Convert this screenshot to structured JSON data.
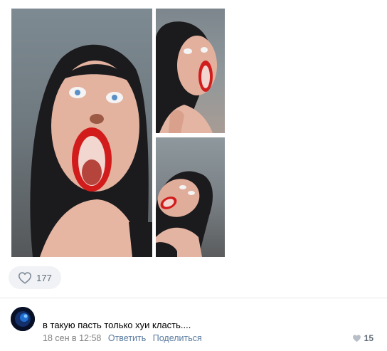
{
  "post": {
    "photos": [
      {
        "id": "photo-main",
        "description": "woman with dark hair screaming, red lipstick"
      },
      {
        "id": "photo-top-right",
        "description": "woman screaming, hand near neck"
      },
      {
        "id": "photo-bottom-right",
        "description": "woman screaming, head tilted"
      }
    ],
    "likes": "177",
    "like_icon": "heart-outline-icon"
  },
  "comment": {
    "text": "в такую пасть только хуи класть....",
    "date": "18 сен в 12:58",
    "reply_label": "Ответить",
    "share_label": "Поделиться",
    "likes": "15",
    "like_icon": "heart-filled-icon"
  },
  "colors": {
    "link": "#5a7ba0",
    "muted": "#828282",
    "pill_bg": "#f0f2f5",
    "divider": "#e7e8ec"
  }
}
